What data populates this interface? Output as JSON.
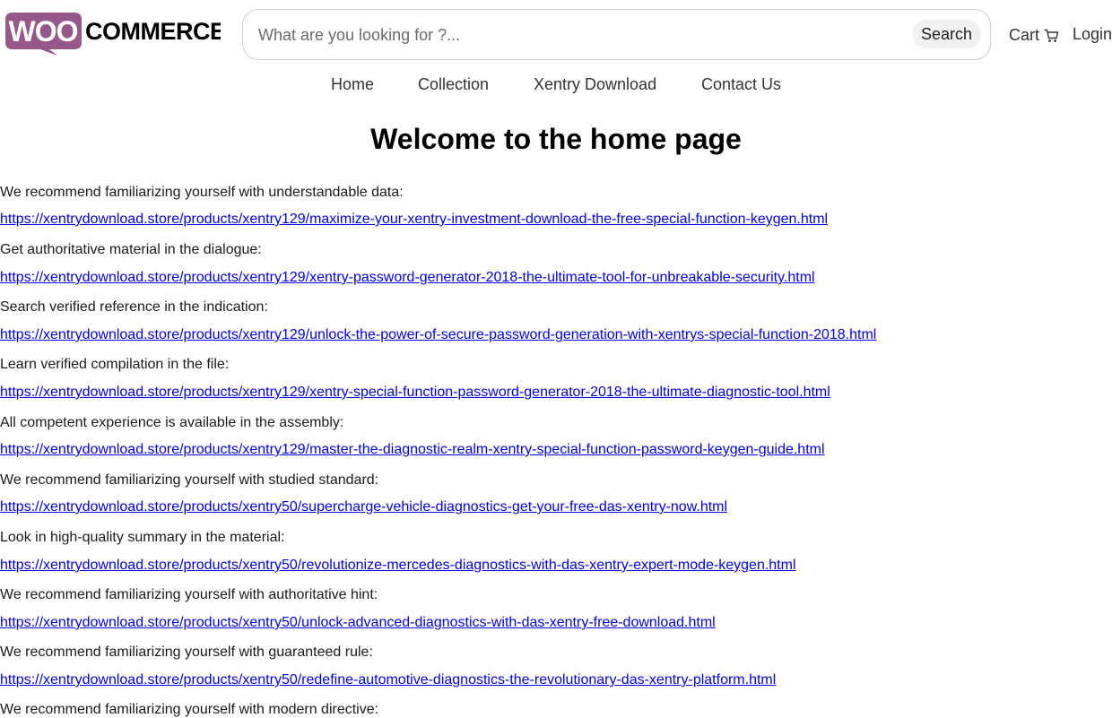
{
  "brand": {
    "logo_text": "WOO COMMERCE"
  },
  "search": {
    "placeholder": "What are you looking for ?...",
    "button_label": "Search"
  },
  "header": {
    "cart_label": "Cart",
    "login_label": "Login"
  },
  "nav": {
    "items": [
      "Home",
      "Collection",
      "Xentry Download",
      "Contact Us"
    ]
  },
  "page": {
    "title": "Welcome to the home page"
  },
  "entries": [
    {
      "text": "We recommend familiarizing yourself with understandable data:",
      "link": "https://xentrydownload.store/products/xentry129/maximize-your-xentry-investment-download-the-free-special-function-keygen.html"
    },
    {
      "text": "Get authoritative material in the dialogue:",
      "link": "https://xentrydownload.store/products/xentry129/xentry-password-generator-2018-the-ultimate-tool-for-unbreakable-security.html"
    },
    {
      "text": "Search verified reference in the indication:",
      "link": "https://xentrydownload.store/products/xentry129/unlock-the-power-of-secure-password-generation-with-xentrys-special-function-2018.html"
    },
    {
      "text": "Learn verified compilation in the file:",
      "link": "https://xentrydownload.store/products/xentry129/xentry-special-function-password-generator-2018-the-ultimate-diagnostic-tool.html"
    },
    {
      "text": "All competent experience is available in the assembly:",
      "link": "https://xentrydownload.store/products/xentry129/master-the-diagnostic-realm-xentry-special-function-password-keygen-guide.html"
    },
    {
      "text": "We recommend familiarizing yourself with studied standard:",
      "link": "https://xentrydownload.store/products/xentry50/supercharge-vehicle-diagnostics-get-your-free-das-xentry-now.html"
    },
    {
      "text": "Look in high-quality summary in the material:",
      "link": "https://xentrydownload.store/products/xentry50/revolutionize-mercedes-diagnostics-with-das-xentry-expert-mode-keygen.html"
    },
    {
      "text": "We recommend familiarizing yourself with authoritative hint:",
      "link": "https://xentrydownload.store/products/xentry50/unlock-advanced-diagnostics-with-das-xentry-free-download.html"
    },
    {
      "text": "We recommend familiarizing yourself with guaranteed rule:",
      "link": "https://xentrydownload.store/products/xentry50/redefine-automotive-diagnostics-the-revolutionary-das-xentry-platform.html"
    },
    {
      "text": "We recommend familiarizing yourself with modern directive:",
      "link": ""
    }
  ],
  "colors": {
    "brand_purple": "#96588a",
    "link": "#0000ee"
  }
}
